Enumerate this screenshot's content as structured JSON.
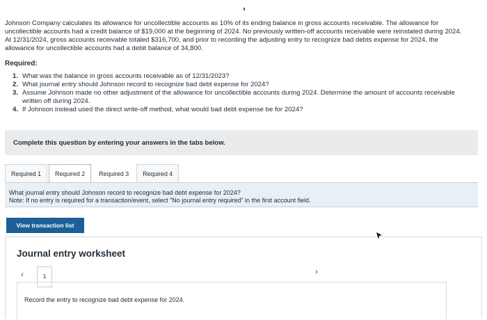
{
  "problem": {
    "intro": "Johnson Company calculates its allowance for uncollectible accounts as 10% of its ending balance in gross accounts receivable. The allowance for uncollectible accounts had a credit balance of $19,000 at the beginning of 2024. No previously written-off accounts receivable were reinstated during 2024. At 12/31/2024, gross accounts receivable totaled $316,700, and prior to recording the adjusting entry to recognize bad debts expense for 2024, the allowance for uncollectible accounts had a debit balance of 34,800.",
    "required_heading": "Required:",
    "requirements": [
      {
        "num": "1.",
        "text": "What was the balance in gross accounts receivable as of 12/31/2023?"
      },
      {
        "num": "2.",
        "text": "What journal entry should Johnson record to recognize bad debt expense for 2024?"
      },
      {
        "num": "3.",
        "text": "Assume Johnson made no other adjustment of the allowance for uncollectible accounts during 2024. Determine the amount of accounts receivable written off during 2024."
      },
      {
        "num": "4.",
        "text": "If Johnson instead used the direct write-off method, what would bad debt expense be for 2024?"
      }
    ]
  },
  "instructions": "Complete this question by entering your answers in the tabs below.",
  "tabs": [
    {
      "label": "Required 1"
    },
    {
      "label": "Required 2"
    },
    {
      "label": "Required 3"
    },
    {
      "label": "Required 4"
    }
  ],
  "active_tab": "Required 2",
  "question": {
    "text": "What journal entry should Johnson record to recognize bad debt expense for 2024?",
    "note": "Note: If no entry is required for a transaction/event, select \"No journal entry required\" in the first account field."
  },
  "view_button": "View transaction list",
  "worksheet": {
    "title": "Journal entry worksheet",
    "prev_icon": "chevron-left-icon",
    "next_icon": "chevron-right-icon",
    "page": "1",
    "entry_prompt": "Record the entry to recognize bad debt expense for 2024."
  },
  "colors": {
    "button_bg": "#1d5f96",
    "info_bg": "#e8eff5",
    "instructions_bg": "#e9ebec"
  }
}
